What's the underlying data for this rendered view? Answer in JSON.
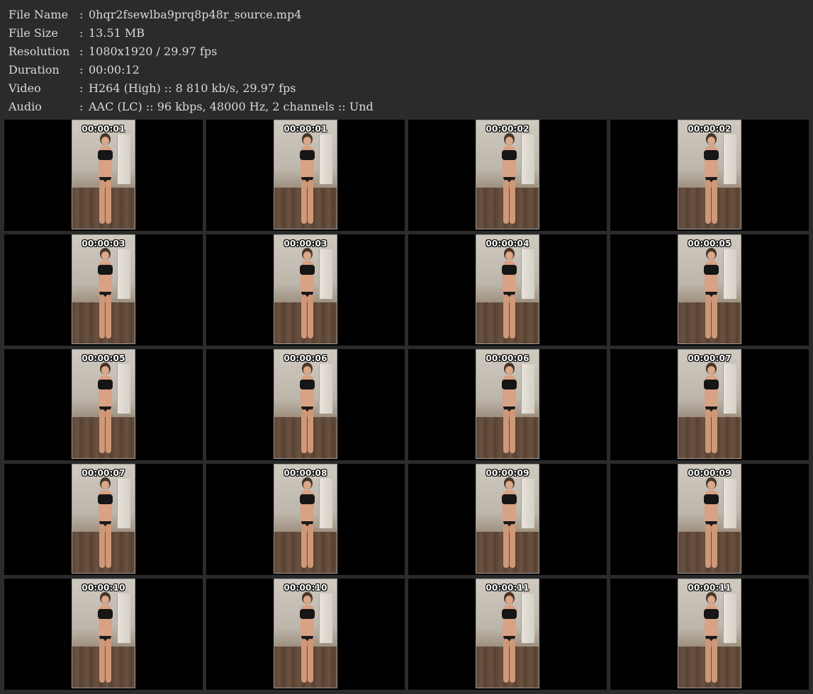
{
  "info": [
    {
      "label": "File Name",
      "value": "0hqr2fsewlba9prq8p48r_source.mp4"
    },
    {
      "label": "File Size",
      "value": "13.51 MB"
    },
    {
      "label": "Resolution",
      "value": "1080x1920 / 29.97 fps"
    },
    {
      "label": "Duration",
      "value": "00:00:12"
    },
    {
      "label": "Video",
      "value": "H264 (High) :: 8 810 kb/s, 29.97 fps"
    },
    {
      "label": "Audio",
      "value": "AAC (LC) :: 96 kbps, 48000 Hz, 2 channels :: Und"
    }
  ],
  "separator": ":",
  "thumbnails": [
    "00:00:01",
    "00:00:01",
    "00:00:02",
    "00:00:02",
    "00:00:03",
    "00:00:03",
    "00:00:04",
    "00:00:05",
    "00:00:05",
    "00:00:06",
    "00:00:06",
    "00:00:07",
    "00:00:07",
    "00:00:08",
    "00:00:09",
    "00:00:09",
    "00:00:10",
    "00:00:10",
    "00:00:11",
    "00:00:11"
  ]
}
